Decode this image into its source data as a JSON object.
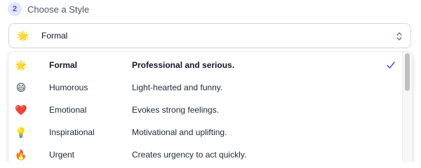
{
  "step": {
    "number": "2",
    "title": "Choose a Style"
  },
  "select": {
    "selected_emoji": "🌟",
    "selected_value": "Formal",
    "chevron_icon": "chevron-up-down-icon"
  },
  "options": [
    {
      "emoji": "🌟",
      "label": "Formal",
      "description": "Professional and serious.",
      "selected": true
    },
    {
      "emoji": "😄",
      "label": "Humorous",
      "description": "Light-hearted and funny.",
      "selected": false
    },
    {
      "emoji": "❤️",
      "label": "Emotional",
      "description": "Evokes strong feelings.",
      "selected": false
    },
    {
      "emoji": "💡",
      "label": "Inspirational",
      "description": "Motivational and uplifting.",
      "selected": false
    },
    {
      "emoji": "🔥",
      "label": "Urgent",
      "description": "Creates urgency to act quickly.",
      "selected": false
    }
  ],
  "colors": {
    "accent": "#4f46e5",
    "badge_bg": "#e0e7ff",
    "border": "#d1d5db"
  }
}
